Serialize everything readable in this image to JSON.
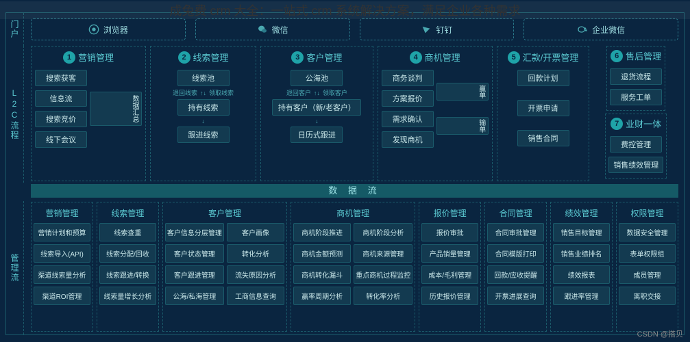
{
  "title": "成兔费 crm 大全：一站式 crm 系统解决方案，满足企业各种需求",
  "watermark": "CSDN @搭贝",
  "side_labels": {
    "portal": "门户",
    "l2c": "L2C流程",
    "mgmt": "管理流"
  },
  "portal": {
    "browser": "浏览器",
    "wechat": "微信",
    "dingtalk": "钉钉",
    "wecom": "企业微信"
  },
  "l2c": {
    "marketing": {
      "num": "1",
      "title": "营销管理",
      "items": [
        "搜索获客",
        "信息流",
        "搜索竞价",
        "线下会议"
      ],
      "aggregate": "数据汇总"
    },
    "leads": {
      "num": "2",
      "title": "线索管理",
      "pool": "线索池",
      "return": "退回线索",
      "claim": "领取线索",
      "hold": "持有线索",
      "follow": "跟进线索"
    },
    "customer": {
      "num": "3",
      "title": "客户管理",
      "pool": "公海池",
      "return": "退回客户",
      "claim": "领取客户",
      "hold": "持有客户（新/老客户）",
      "calendar": "日历式跟进"
    },
    "opp": {
      "num": "4",
      "title": "商机管理",
      "items": [
        "商务谈判",
        "方案报价",
        "需求确认",
        "发现商机"
      ],
      "win": "赢单",
      "lose": "输单"
    },
    "invoice": {
      "num": "5",
      "title": "汇款/开票管理",
      "items": [
        "回款计划",
        "开票申请",
        "销售合同"
      ]
    },
    "after_sales": {
      "num": "6",
      "title": "售后管理",
      "items": [
        "退货流程",
        "服务工单"
      ]
    },
    "finance": {
      "num": "7",
      "title": "业财一体",
      "items": [
        "费控管理",
        "销售绩效管理"
      ]
    }
  },
  "dataflow_label": "数 据 流",
  "mgmt_cols": [
    {
      "header": "营销管理",
      "cols": [
        [
          "营销计划和预算",
          "线索导入(API)",
          "渠道线索量分析",
          "渠道ROI管理"
        ]
      ]
    },
    {
      "header": "线索管理",
      "cols": [
        [
          "线索查重",
          "线索分配/回收",
          "线索跟进/转换",
          "线索量增长分析"
        ]
      ]
    },
    {
      "header": "客户管理",
      "cols": [
        [
          "客户信息分层管理",
          "客户状态管理",
          "客户跟进管理",
          "公海/私海管理"
        ],
        [
          "客户画像",
          "转化分析",
          "流失原因分析",
          "工商信息查询"
        ]
      ]
    },
    {
      "header": "商机管理",
      "cols": [
        [
          "商机阶段推进",
          "商机金额预测",
          "商机转化漏斗",
          "赢率周期分析"
        ],
        [
          "商机阶段分析",
          "商机来源管理",
          "重点商机过程监控",
          "转化率分析"
        ]
      ]
    },
    {
      "header": "报价管理",
      "cols": [
        [
          "报价审批",
          "产品销量管理",
          "成本/毛利管理",
          "历史报价管理"
        ]
      ]
    },
    {
      "header": "合同管理",
      "cols": [
        [
          "合同审批管理",
          "合同模版打印",
          "回款/应收提醒",
          "开票进展查询"
        ]
      ]
    },
    {
      "header": "绩效管理",
      "cols": [
        [
          "销售目标管理",
          "销售业绩排名",
          "绩效报表",
          "跟进率管理"
        ]
      ]
    },
    {
      "header": "权限管理",
      "cols": [
        [
          "数据安全管理",
          "表单权限组",
          "成员管理",
          "离职交接"
        ]
      ]
    }
  ]
}
